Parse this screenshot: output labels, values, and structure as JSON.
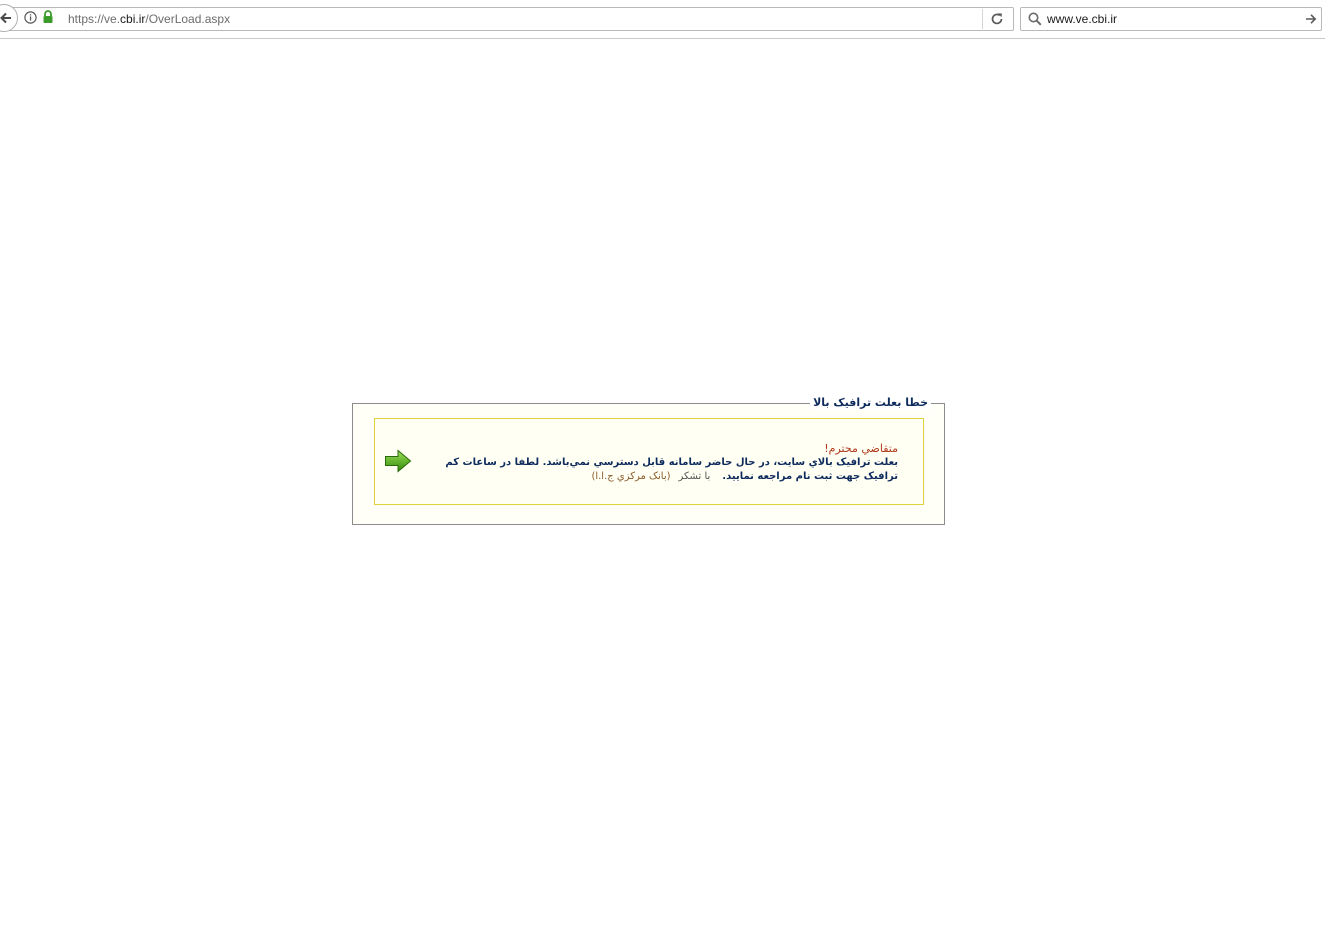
{
  "browser": {
    "url_prefix": "https://ve.",
    "url_host": "cbi.ir",
    "url_path": "/OverLoad.aspx",
    "search_value": "www.ve.cbi.ir"
  },
  "error_panel": {
    "legend": "خطا بعلت ترافيک بالا",
    "greeting": "متقاضي محترم!",
    "message": "بعلت ترافيک بالاي سايت، در حال حاضر سامانه قابل دسترسي نمي‌باشد. لطفا در ساعات کم ترافيک جهت ثبت نام مراجعه نماييد.",
    "thanks": "با تشکر",
    "signature": "(بانک مرکزي ج.ا.ا)"
  },
  "colors": {
    "legend_text": "#0d2a5c",
    "greeting_text": "#b03a1a",
    "inner_border": "#e0d23a",
    "arrow": "#3a9a10"
  },
  "icons": {
    "back": "back-arrow-icon",
    "info": "info-icon",
    "lock": "lock-icon",
    "reload": "reload-icon",
    "search": "search-icon",
    "go": "go-arrow-icon",
    "notice": "green-arrow-icon"
  }
}
